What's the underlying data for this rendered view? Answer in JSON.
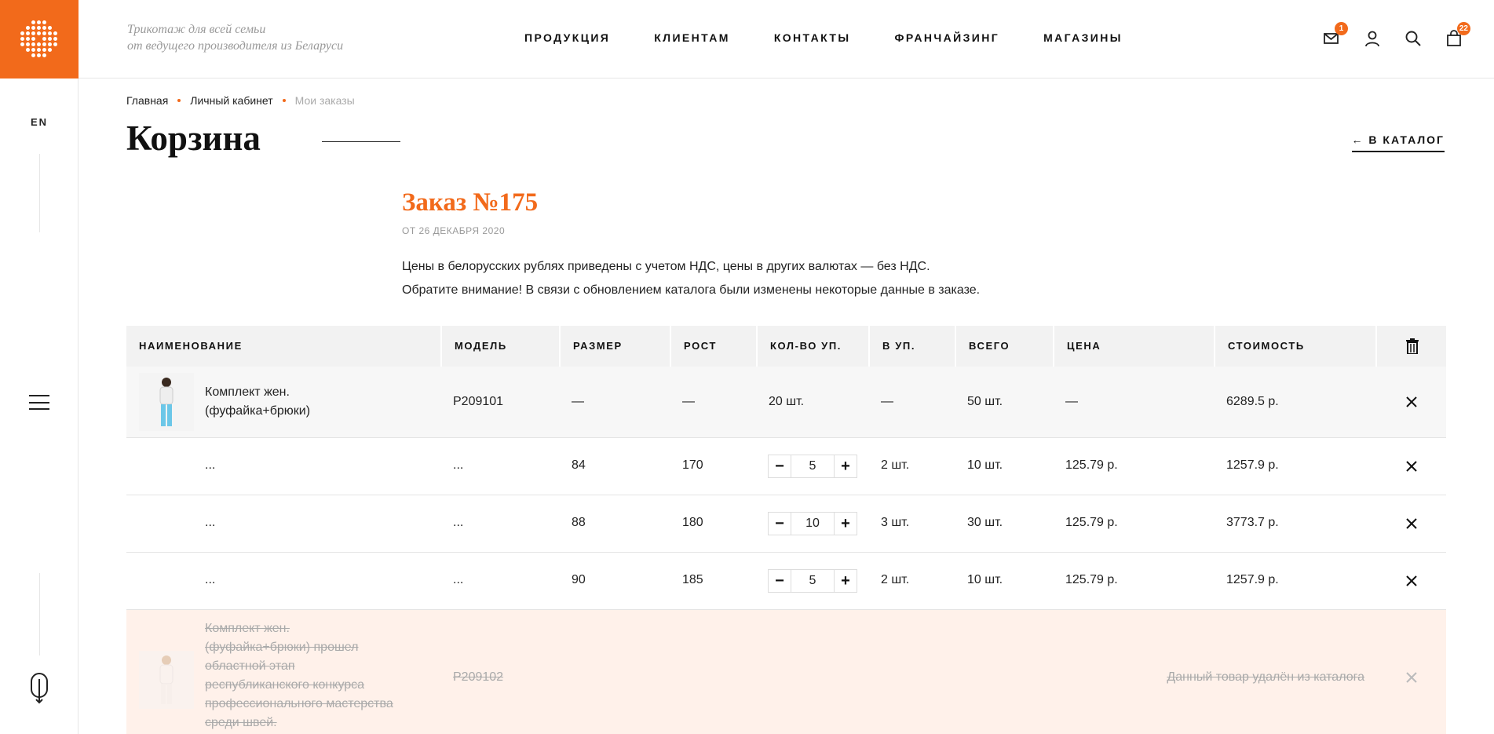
{
  "header": {
    "tagline_line1": "Трикотаж для всей семьи",
    "tagline_line2": "от ведущего производителя из Беларуси",
    "nav": [
      "ПРОДУКЦИЯ",
      "КЛИЕНТАМ",
      "КОНТАКТЫ",
      "ФРАНЧАЙЗИНГ",
      "МАГАЗИНЫ"
    ],
    "messages_count": "1",
    "cart_count": "22"
  },
  "rail": {
    "lang": "EN"
  },
  "breadcrumb": [
    "Главная",
    "Личный кабинет",
    "Мои заказы"
  ],
  "page_title": "Корзина",
  "to_catalog": "← В КАТАЛОГ",
  "order": {
    "title": "Заказ №175",
    "date": "ОТ 26 ДЕКАБРЯ 2020",
    "note1": "Цены в белорусских рублях приведены с учетом НДС, цены в других валютах — без НДС.",
    "note2": "Обратите внимание! В связи с обновлением каталога были изменены некоторые данные в заказе."
  },
  "table": {
    "headers": [
      "НАИМЕНОВАНИЕ",
      "МОДЕЛЬ",
      "РАЗМЕР",
      "РОСТ",
      "КОЛ-ВО УП.",
      "В УП.",
      "ВСЕГО",
      "ЦЕНА",
      "СТОИМОСТЬ"
    ],
    "product": {
      "name_line1": "Комплект жен.",
      "name_line2": "(фуфайка+брюки)",
      "model": "P209101",
      "size": "—",
      "height": "—",
      "packs": "20 шт.",
      "per_pack": "—",
      "total": "50 шт.",
      "price": "—",
      "cost": "6289.5 р."
    },
    "variants": [
      {
        "name": "...",
        "model": "...",
        "size": "84",
        "height": "170",
        "qty": "5",
        "per_pack": "2 шт.",
        "total": "10 шт.",
        "price": "125.79 р.",
        "cost": "1257.9 р."
      },
      {
        "name": "...",
        "model": "...",
        "size": "88",
        "height": "180",
        "qty": "10",
        "per_pack": "3 шт.",
        "total": "30 шт.",
        "price": "125.79 р.",
        "cost": "3773.7 р."
      },
      {
        "name": "...",
        "model": "...",
        "size": "90",
        "height": "185",
        "qty": "5",
        "per_pack": "2 шт.",
        "total": "10 шт.",
        "price": "125.79 р.",
        "cost": "1257.9 р."
      }
    ],
    "deleted": {
      "name_lines": [
        "Комплект жен.",
        "(фуфайка+брюки) прошел",
        "областной этап",
        "республиканского конкурса",
        "профессионального мастерства",
        "среди швей."
      ],
      "model": "P209102",
      "message": "Данный товар удалён из каталога"
    },
    "minus": "−",
    "plus": "+"
  },
  "colors": {
    "accent": "#f26a1b",
    "header_bg": "#f2f2f2",
    "deleted_bg": "#fff1ea"
  }
}
